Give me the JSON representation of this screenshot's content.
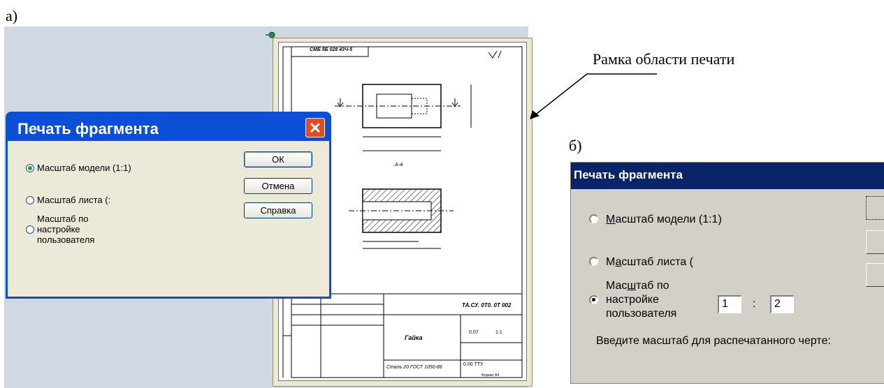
{
  "labels": {
    "a": "а)",
    "b": "б)"
  },
  "callout": {
    "text": "Рамка области печати"
  },
  "drawing": {
    "code_top": "СМБ 5Б 028 43Ч-5",
    "code_block": "ТА.СУ. 0Т0. 0Т 002",
    "part_name": "Гайка",
    "material": "Сталь 20 ГОСТ 1050-88",
    "section": "А-А",
    "scale": "1:1",
    "mass": "0.07",
    "rough": "0.00 ТТУ",
    "format": "Формат А4"
  },
  "dialog_a": {
    "title": "Печать фрагмента",
    "options": [
      {
        "label": "Масштаб модели (1:1)",
        "selected": true
      },
      {
        "label": "Масштаб листа (:",
        "selected": false
      },
      {
        "label_lines": [
          "Масштаб по",
          "настройке",
          "пользователя"
        ],
        "selected": false
      }
    ],
    "buttons": {
      "ok": "ОК",
      "cancel": "Отмена",
      "help": "Справка"
    }
  },
  "dialog_b": {
    "title": "Печать фрагмента",
    "option1": {
      "before": "",
      "mnemonic": "М",
      "after": "асштаб модели (1:1)",
      "selected": false
    },
    "option2": {
      "before": "М",
      "mnemonic": "а",
      "after": "сштаб листа (",
      "selected": false
    },
    "option3": {
      "line1_before": "Мас",
      "line1_mnemonic": "ш",
      "line1_after": "таб по",
      "line2": "настройке",
      "line3": "пользователя",
      "selected": true
    },
    "ratio_left": "1",
    "ratio_sep": ":",
    "ratio_right": "2",
    "hint": "Введите масштаб для распечатанного черте:"
  },
  "colors": {
    "xp_title": "#0a4fd6",
    "classic_title": "#0a246a",
    "workspace": "#cfd8e3"
  }
}
